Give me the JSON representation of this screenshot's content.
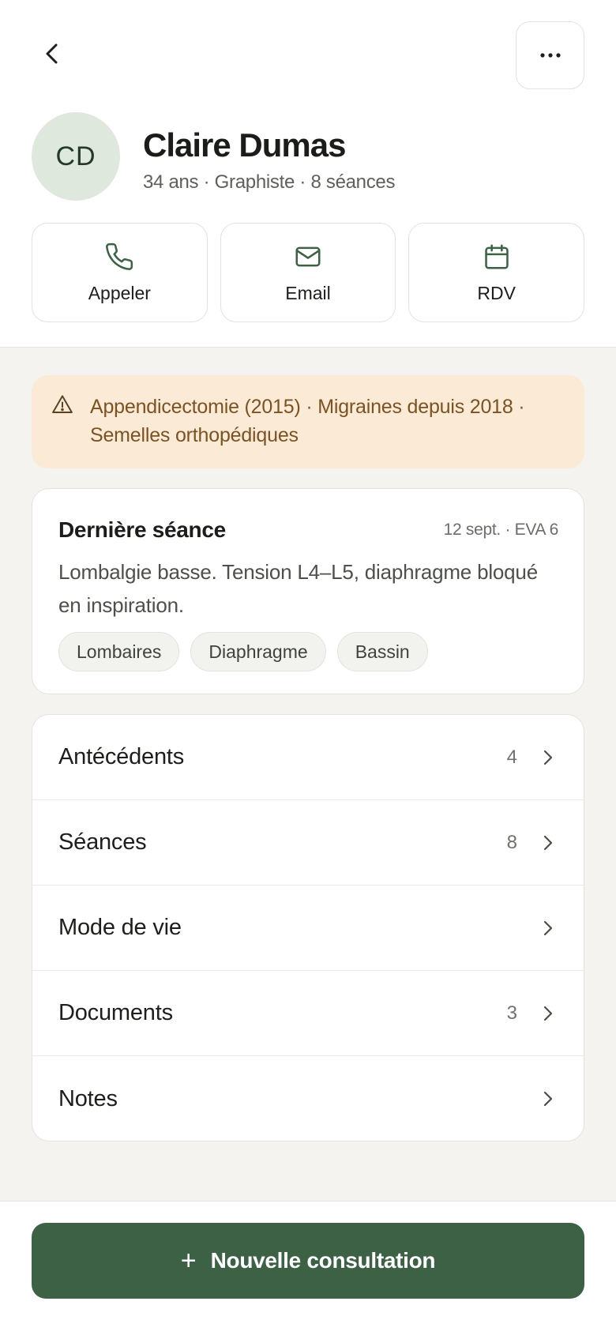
{
  "header": {
    "back_icon": "chevron-left-icon",
    "more_icon": "more-horizontal-icon"
  },
  "patient": {
    "initials": "CD",
    "name": "Claire Dumas",
    "meta": "34 ans · Graphiste · 8 séances"
  },
  "actions": [
    {
      "label": "Appeler",
      "icon": "phone-icon"
    },
    {
      "label": "Email",
      "icon": "mail-icon"
    },
    {
      "label": "RDV",
      "icon": "calendar-icon"
    }
  ],
  "alert": {
    "icon": "warning-icon",
    "text": "Appendicectomie (2015) · Migraines depuis 2018 · Semelles orthopédiques"
  },
  "last_session": {
    "title": "Dernière séance",
    "date": "12 sept. · EVA 6",
    "body": "Lombalgie basse. Tension L4–L5, diaphragme bloqué en inspiration.",
    "tags": [
      "Lombaires",
      "Diaphragme",
      "Bassin"
    ]
  },
  "menu": [
    {
      "label": "Antécédents",
      "count": "4"
    },
    {
      "label": "Séances",
      "count": "8"
    },
    {
      "label": "Mode de vie",
      "count": ""
    },
    {
      "label": "Documents",
      "count": "3"
    },
    {
      "label": "Notes",
      "count": ""
    }
  ],
  "cta": {
    "plus": "+",
    "label": "Nouvelle consultation"
  },
  "colors": {
    "brand_green": "#3d6145",
    "alert_bg": "#fbebd6",
    "alert_text": "#7b5222",
    "avatar_bg": "#dfe8dc"
  }
}
